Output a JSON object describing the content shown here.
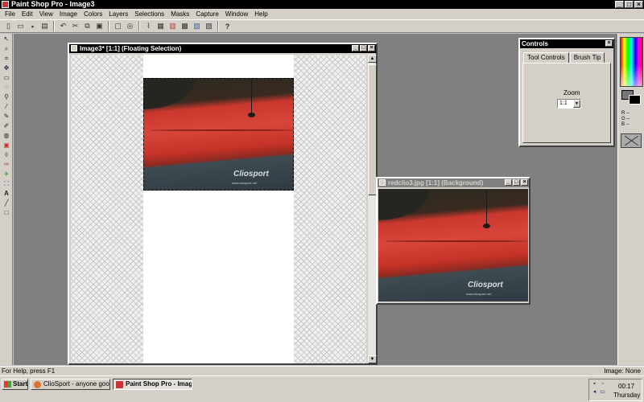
{
  "app": {
    "title": "Paint Shop Pro - Image3",
    "controls": {
      "minimize": "_",
      "maximize": "□",
      "close": "×"
    }
  },
  "menu": [
    "File",
    "Edit",
    "View",
    "Image",
    "Colors",
    "Layers",
    "Selections",
    "Masks",
    "Capture",
    "Window",
    "Help"
  ],
  "toolbar_icons": [
    "new-icon",
    "open-icon",
    "save-icon",
    "print-icon",
    "undo-icon",
    "cut-icon",
    "copy-icon",
    "paste-icon",
    "browse-icon",
    "help-icon"
  ],
  "tools": [
    "arrow-tool",
    "zoom-tool",
    "crop-tool",
    "mover-tool",
    "selection-tool",
    "freehand-tool",
    "magic-wand-tool",
    "dropper-tool",
    "paintbrush-tool",
    "clone-tool",
    "color-replacer-tool",
    "retouch-tool",
    "eraser-tool",
    "picture-tube-tool",
    "airbrush-tool",
    "flood-fill-tool",
    "text-tool",
    "line-tool",
    "shape-tool"
  ],
  "image_window": {
    "title": "Image3* [1:1] (Floating Selection)",
    "watermark_brand": "Cliosport",
    "watermark_url": "www.cliosport.net"
  },
  "photo_window": {
    "title": "redclio3.jpg [1:1] (Background)",
    "watermark_brand": "Cliosport",
    "watermark_url": "www.cliosport.net"
  },
  "controls_panel": {
    "title": "Controls",
    "tabs": [
      "Tool Controls",
      "Brush Tip"
    ],
    "zoom_label": "Zoom",
    "zoom_value": "1:1"
  },
  "color_panel": {
    "rgb": [
      "R --",
      "G --",
      "B --"
    ],
    "foreground": "#777777",
    "background": "#000000"
  },
  "status": {
    "left": "For Help, press F1",
    "right": "Image: None"
  },
  "taskbar": {
    "start": "Start",
    "tasks": [
      "ClioSport - anyone good ...",
      "Paint Shop Pro - Imag..."
    ],
    "time": "00:17",
    "day": "Thursday"
  },
  "colors": {
    "titlebar_active": "#000000",
    "titlebar_inactive": "#808080",
    "workspace": "#808080",
    "car_red": "#c9372d"
  }
}
